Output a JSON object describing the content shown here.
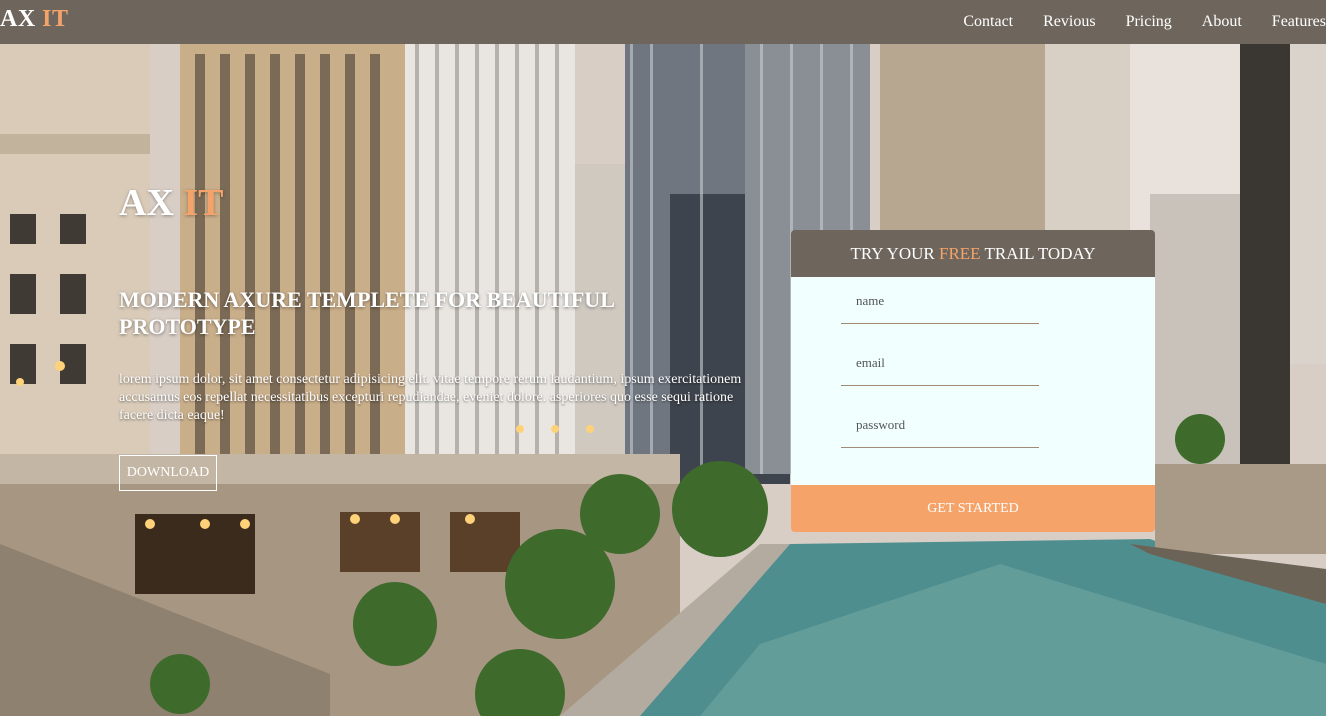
{
  "nav": {
    "brand_main": "AX",
    "brand_accent": "IT",
    "links": [
      "Contact",
      "Revious",
      "Pricing",
      "About",
      "Features"
    ]
  },
  "hero": {
    "logo_main": "AX",
    "logo_accent": "IT",
    "title": "MODERN AXURE TEMPLETE FOR BEAUTIFUL PROTOTYPE",
    "description": "lorem ipsum dolor, sit amet consectetur adipisicing elit. vitae tempore rerum laudantium, ipsum exercitationem accusamus eos repellat necessitatibus excepturi repudiandae, eveniet dolore. asperiores quo esse sequi ratione facere dicta eaque!",
    "download_label": "DOWNLOAD"
  },
  "signup": {
    "header_before": "TRY YOUR ",
    "header_accent": "FREE",
    "header_after": " TRAIL TODAY",
    "name_placeholder": "name",
    "email_placeholder": "email",
    "password_placeholder": "password",
    "submit_label": "GET STARTED"
  },
  "colors": {
    "nav_bg": "#6e665c",
    "accent": "#f4a46a",
    "card_body_bg": "#f1fffe",
    "button_bg": "#f6a369"
  }
}
